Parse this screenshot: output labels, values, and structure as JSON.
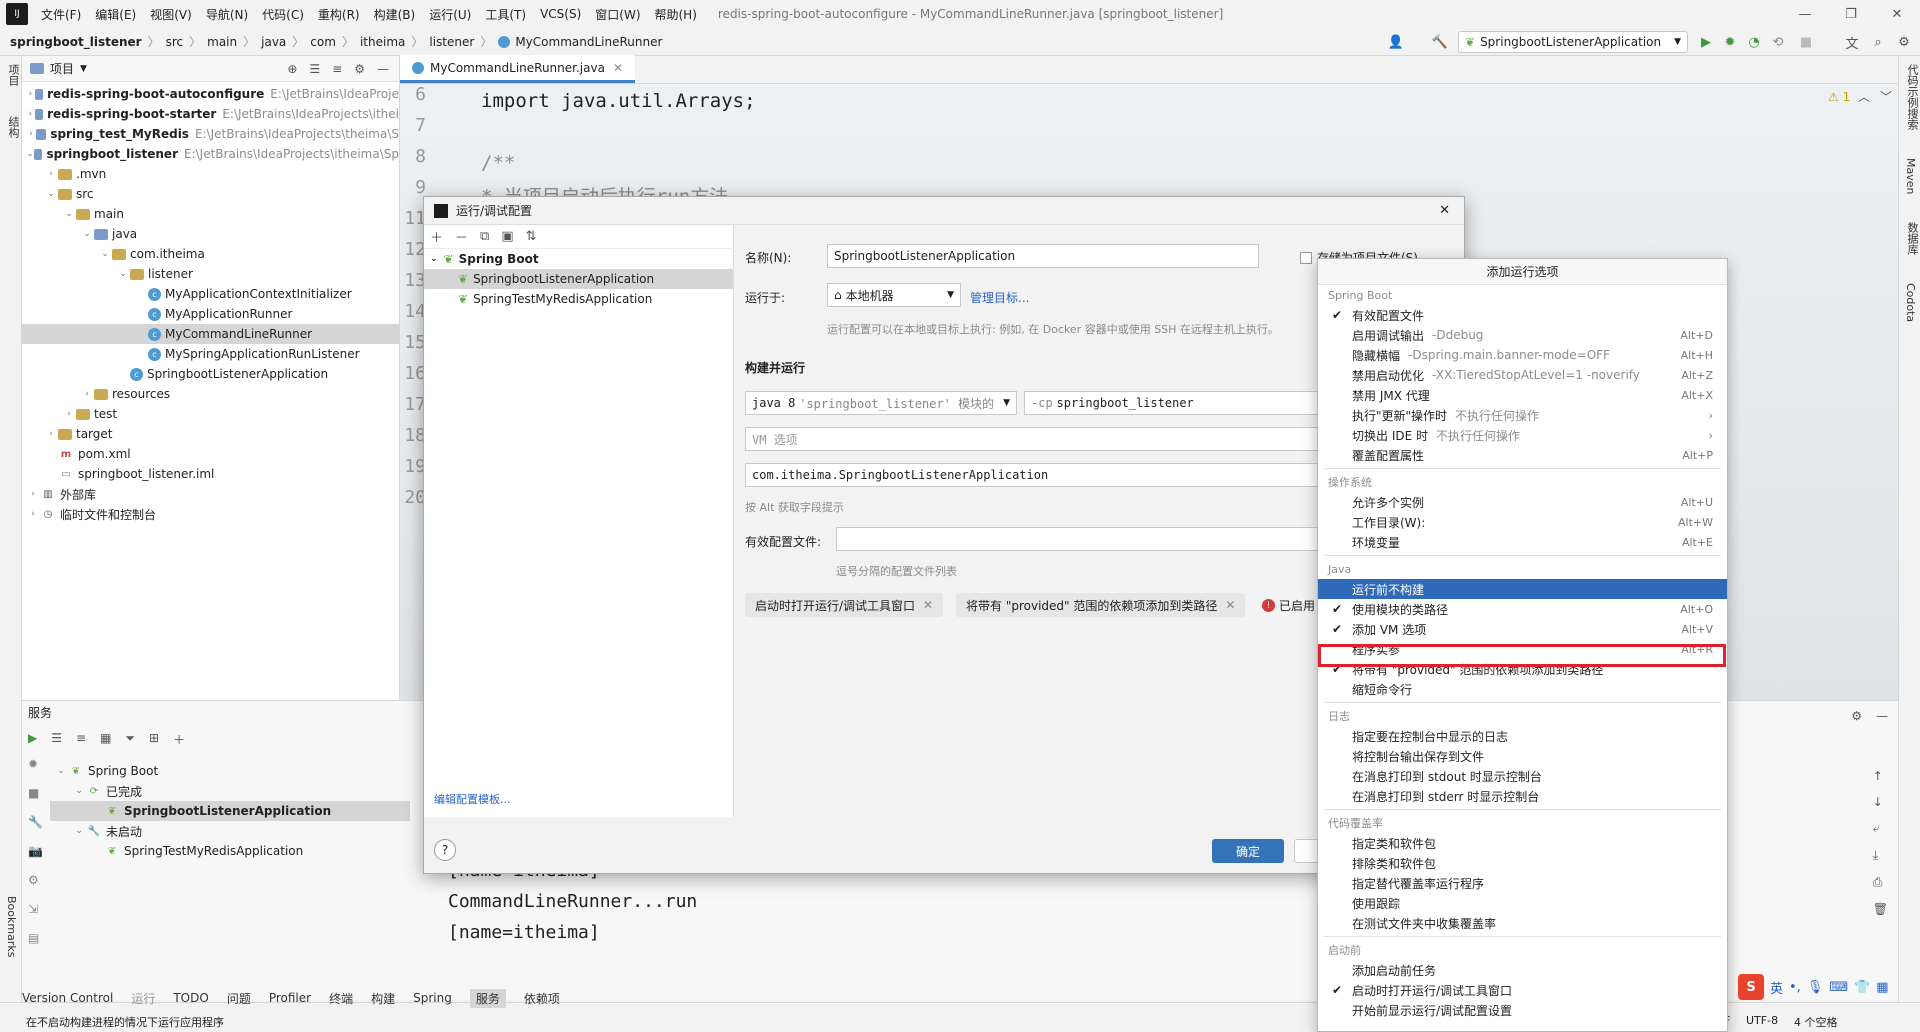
{
  "menubar": {
    "items": [
      "文件(F)",
      "编辑(E)",
      "视图(V)",
      "导航(N)",
      "代码(C)",
      "重构(R)",
      "构建(B)",
      "运行(U)",
      "工具(T)",
      "VCS(S)",
      "窗口(W)",
      "帮助(H)"
    ],
    "title": "redis-spring-boot-autoconfigure - MyCommandLineRunner.java [springboot_listener]"
  },
  "breadcrumb": [
    "springboot_listener",
    "src",
    "main",
    "java",
    "com",
    "itheima",
    "listener",
    "MyCommandLineRunner"
  ],
  "run_config": "SpringbootListenerApplication",
  "project_panel": {
    "title": "项目",
    "tree": [
      {
        "l": 0,
        "a": "›",
        "ic": "folderb",
        "t": "redis-spring-boot-autoconfigure",
        "p": "E:\\JetBrains\\IdeaProje",
        "b": true
      },
      {
        "l": 0,
        "a": "›",
        "ic": "folderb",
        "t": "redis-spring-boot-starter",
        "p": "E:\\JetBrains\\IdeaProjects\\ithei",
        "b": true
      },
      {
        "l": 0,
        "a": "›",
        "ic": "folderb",
        "t": "spring_test_MyRedis",
        "p": "E:\\JetBrains\\IdeaProjects\\theima\\S",
        "b": true
      },
      {
        "l": 0,
        "a": "⌄",
        "ic": "folderb",
        "t": "springboot_listener",
        "p": "E:\\JetBrains\\IdeaProjects\\itheima\\Sp",
        "b": true
      },
      {
        "l": 1,
        "a": "›",
        "ic": "folder",
        "t": ".mvn",
        "p": ""
      },
      {
        "l": 1,
        "a": "⌄",
        "ic": "folder",
        "t": "src",
        "p": ""
      },
      {
        "l": 2,
        "a": "⌄",
        "ic": "folder",
        "t": "main",
        "p": ""
      },
      {
        "l": 3,
        "a": "⌄",
        "ic": "folderb",
        "t": "java",
        "p": ""
      },
      {
        "l": 4,
        "a": "⌄",
        "ic": "folder",
        "t": "com.itheima",
        "p": ""
      },
      {
        "l": 5,
        "a": "⌄",
        "ic": "folder",
        "t": "listener",
        "p": ""
      },
      {
        "l": 6,
        "a": "",
        "ic": "cls",
        "t": "MyApplicationContextInitializer",
        "p": ""
      },
      {
        "l": 6,
        "a": "",
        "ic": "cls",
        "t": "MyApplicationRunner",
        "p": ""
      },
      {
        "l": 6,
        "a": "",
        "ic": "cls",
        "t": "MyCommandLineRunner",
        "p": "",
        "sel": true
      },
      {
        "l": 6,
        "a": "",
        "ic": "cls",
        "t": "MySpringApplicationRunListener",
        "p": ""
      },
      {
        "l": 5,
        "a": "",
        "ic": "cls",
        "t": "SpringbootListenerApplication",
        "p": ""
      },
      {
        "l": 3,
        "a": "›",
        "ic": "folder",
        "t": "resources",
        "p": ""
      },
      {
        "l": 2,
        "a": "›",
        "ic": "folder",
        "t": "test",
        "p": ""
      },
      {
        "l": 1,
        "a": "›",
        "ic": "folder",
        "t": "target",
        "p": ""
      },
      {
        "l": 1,
        "a": "",
        "ic": "m",
        "t": "pom.xml",
        "p": ""
      },
      {
        "l": 1,
        "a": "",
        "ic": "f",
        "t": "springboot_listener.iml",
        "p": ""
      },
      {
        "l": 0,
        "a": "›",
        "ic": "lib",
        "t": "外部库",
        "p": ""
      },
      {
        "l": 0,
        "a": "›",
        "ic": "scr",
        "t": "临时文件和控制台",
        "p": ""
      }
    ]
  },
  "editor": {
    "tab": "MyCommandLineRunner.java",
    "line_numbers": [
      "6",
      "7",
      "8",
      "9",
      "11",
      "12",
      "13",
      "14",
      "15",
      "16",
      "17",
      "18",
      "19",
      "20"
    ],
    "line1": "import java.util.Arrays;",
    "line3": "/**",
    "line4": " * 当项目启动后执行run方法"
  },
  "services": {
    "title": "服务",
    "tree": [
      {
        "l": 0,
        "t": "Spring Boot"
      },
      {
        "l": 1,
        "t": "已完成"
      },
      {
        "l": 2,
        "t": "SpringbootListenerApplication",
        "sel": true
      },
      {
        "l": 1,
        "t": "未启动"
      },
      {
        "l": 2,
        "t": "SpringTestMyRedisApplication"
      }
    ],
    "console": [
      "[name=itheima]",
      "CommandLineRunner...run",
      "[name=itheima]"
    ]
  },
  "dialog": {
    "title": "运行/调试配置",
    "tree_root": "Spring Boot",
    "tree_items": [
      "SpringbootListenerApplication",
      "SpringTestMyRedisApplication"
    ],
    "edit_templates": "编辑配置模板...",
    "name_label": "名称(N):",
    "name_value": "SpringbootListenerApplication",
    "store_label": "存储为项目文件(S)",
    "run_on_label": "运行于:",
    "run_on_value": "本地机器",
    "manage_targets": "管理目标...",
    "run_on_hint": "运行配置可以在本地或目标上执行: 例如, 在 Docker 容器中或使用 SSH 在远程主机上执行。",
    "build_run": "构建并运行",
    "jdk_prefix": "java 8",
    "jdk_module": "'springboot_listener' 模块的",
    "cp_flag": "-cp",
    "cp_value": "springboot_listener",
    "vm_placeholder": "VM 选项",
    "main_class": "com.itheima.SpringbootListenerApplication",
    "alt_hint": "按 Alt 获取字段提示",
    "profiles_label": "有效配置文件:",
    "profiles_hint": "逗号分隔的配置文件列表",
    "chip1": "启动时打开运行/调试工具窗口",
    "chip2": "将带有 \"provided\" 范围的依赖项添加到类路径",
    "enabled_text": "已启用",
    "ok": "确定"
  },
  "popup": {
    "title": "添加运行选项",
    "sections": [
      {
        "name": "Spring Boot",
        "items": [
          {
            "c": true,
            "t": "有效配置文件"
          },
          {
            "t": "启用调试输出",
            "s": "-Ddebug",
            "k": "Alt+D"
          },
          {
            "t": "隐藏横幅",
            "s": "-Dspring.main.banner-mode=OFF",
            "k": "Alt+H"
          },
          {
            "t": "禁用启动优化",
            "s": "-XX:TieredStopAtLevel=1 -noverify",
            "k": "Alt+Z"
          },
          {
            "t": "禁用 JMX 代理",
            "k": "Alt+X"
          },
          {
            "t": "执行\"更新\"操作时",
            "s": "不执行任何操作",
            "k": "›"
          },
          {
            "t": "切换出 IDE 时",
            "s": "不执行任何操作",
            "k": "›"
          },
          {
            "t": "覆盖配置属性",
            "k": "Alt+P"
          }
        ]
      },
      {
        "name": "操作系统",
        "items": [
          {
            "t": "允许多个实例",
            "k": "Alt+U"
          },
          {
            "t": "工作目录(W):",
            "k": "Alt+W"
          },
          {
            "t": "环境变量",
            "k": "Alt+E"
          }
        ]
      },
      {
        "name": "Java",
        "items": [
          {
            "t": "运行前不构建",
            "hl": true
          },
          {
            "c": true,
            "t": "使用模块的类路径",
            "k": "Alt+O"
          },
          {
            "c": true,
            "t": "添加 VM 选项",
            "k": "Alt+V"
          },
          {
            "t": "程序实参",
            "k": "Alt+R"
          },
          {
            "c": true,
            "t": "将带有 \"provided\" 范围的依赖项添加到类路径"
          },
          {
            "t": "缩短命令行"
          }
        ]
      },
      {
        "name": "日志",
        "items": [
          {
            "t": "指定要在控制台中显示的日志"
          },
          {
            "t": "将控制台输出保存到文件"
          },
          {
            "t": "在消息打印到 stdout 时显示控制台"
          },
          {
            "t": "在消息打印到 stderr 时显示控制台"
          }
        ]
      },
      {
        "name": "代码覆盖率",
        "items": [
          {
            "t": "指定类和软件包"
          },
          {
            "t": "排除类和软件包"
          },
          {
            "t": "指定替代覆盖率运行程序"
          },
          {
            "t": "使用跟踪"
          },
          {
            "t": "在测试文件夹中收集覆盖率"
          }
        ]
      },
      {
        "name": "启动前",
        "items": [
          {
            "t": "添加启动前任务"
          },
          {
            "c": true,
            "t": "启动时打开运行/调试工具窗口"
          },
          {
            "t": "开始前显示运行/调试配置设置"
          }
        ]
      }
    ]
  },
  "bottom_tabs": [
    "Version Control",
    "运行",
    "TODO",
    "问题",
    "Profiler",
    "终端",
    "构建",
    "Spring",
    "服务",
    "依赖项"
  ],
  "status": {
    "message": "在不启动构建进程的情况下运行应用程序",
    "encoding": "UTF-8",
    "indent": "4 个空格",
    "line_sep": "F"
  },
  "warnings": "1",
  "left_tabs": [
    "项目",
    "结构",
    "Bookmarks"
  ],
  "right_tabs": [
    "代码示例搜索",
    "Maven",
    "数据库",
    "Codota"
  ],
  "ime": {
    "lang": "英"
  }
}
